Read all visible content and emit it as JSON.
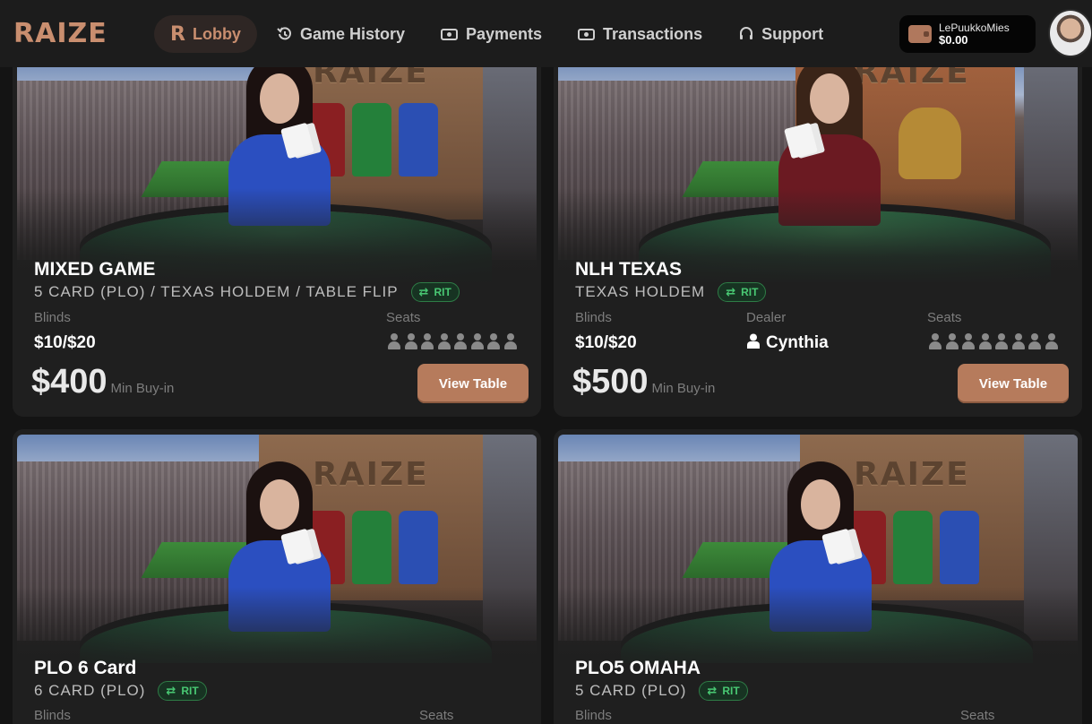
{
  "brand": {
    "logo_text": "RAIZE",
    "accent": "#c98e6f"
  },
  "nav": {
    "items": [
      {
        "label": "Lobby",
        "icon": "raize-r-icon",
        "active": true
      },
      {
        "label": "Game History",
        "icon": "history-icon",
        "active": false
      },
      {
        "label": "Payments",
        "icon": "cash-icon",
        "active": false
      },
      {
        "label": "Transactions",
        "icon": "cash-icon",
        "active": false
      },
      {
        "label": "Support",
        "icon": "headset-icon",
        "active": false
      }
    ]
  },
  "wallet": {
    "username": "LePuukkoMies",
    "balance": "$0.00",
    "icon": "wallet-icon"
  },
  "tables": [
    {
      "title": "MIXED GAME",
      "subtitle": "5 CARD (PLO) / TEXAS HOLDEM / TABLE FLIP",
      "badge": "RIT",
      "blinds_label": "Blinds",
      "blinds": "$10/$20",
      "seats_label": "Seats",
      "seat_count": 8,
      "min_buyin": "$400",
      "min_buyin_label": "Min Buy-in",
      "button": "View Table",
      "dealer_shirt": "blue"
    },
    {
      "title": "NLH TEXAS",
      "subtitle": "TEXAS HOLDEM",
      "badge": "RIT",
      "blinds_label": "Blinds",
      "blinds": "$10/$20",
      "dealer_label": "Dealer",
      "dealer_name": "Cynthia",
      "seats_label": "Seats",
      "seat_count": 8,
      "min_buyin": "$500",
      "min_buyin_label": "Min Buy-in",
      "button": "View Table",
      "dealer_shirt": "maroon"
    },
    {
      "title": "PLO 6 Card",
      "subtitle": "6 CARD (PLO)",
      "badge": "RIT",
      "blinds_label": "Blinds",
      "seats_label": "Seats",
      "dealer_shirt": "blue"
    },
    {
      "title": "PLO5 OMAHA",
      "subtitle": "5 CARD (PLO)",
      "badge": "RIT",
      "blinds_label": "Blinds",
      "seats_label": "Seats",
      "dealer_shirt": "blue"
    }
  ]
}
